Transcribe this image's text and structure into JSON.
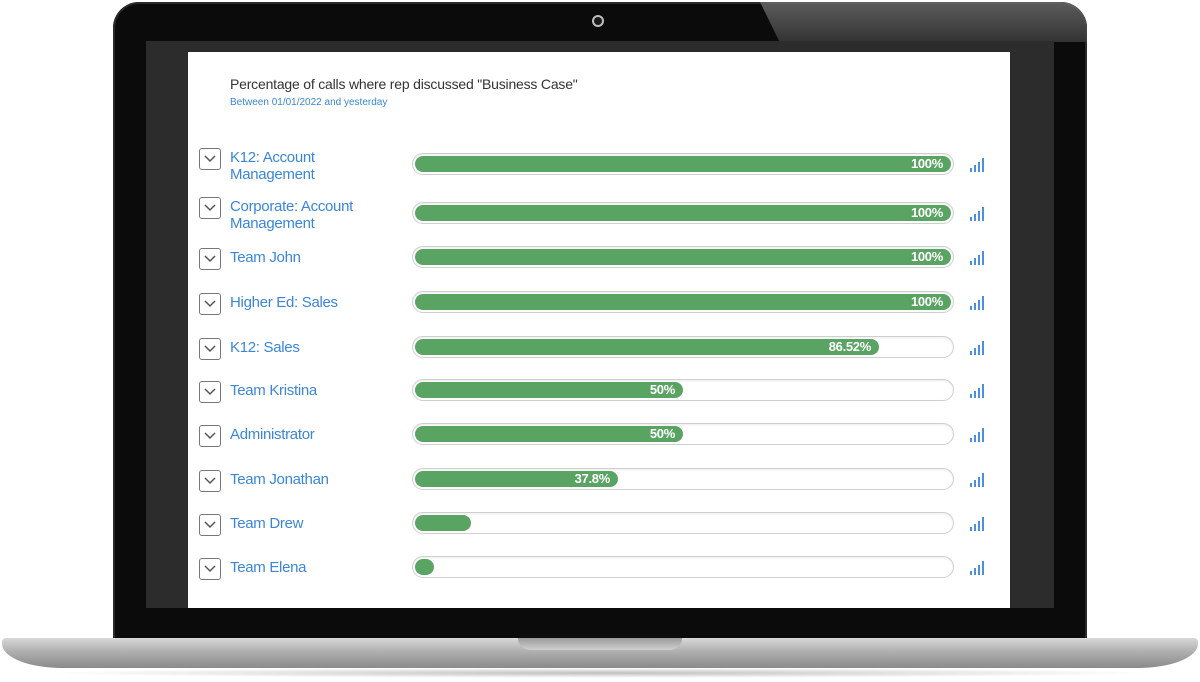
{
  "chart": {
    "title": "Percentage of calls where rep discussed \"Business Case\"",
    "subtitle": "Between 01/01/2022 and yesterday"
  },
  "colors": {
    "bar_fill": "#5aa463",
    "link": "#3a86d8",
    "icon": "#4a8fe0"
  },
  "rows": [
    {
      "label": "K12: Account Management",
      "value": 100,
      "value_label": "100%"
    },
    {
      "label": "Corporate: Account Management",
      "value": 100,
      "value_label": "100%"
    },
    {
      "label": "Team John",
      "value": 100,
      "value_label": "100%"
    },
    {
      "label": "Higher Ed: Sales",
      "value": 100,
      "value_label": "100%"
    },
    {
      "label": "K12: Sales",
      "value": 86.52,
      "value_label": "86.52%"
    },
    {
      "label": "Team Kristina",
      "value": 50,
      "value_label": "50%"
    },
    {
      "label": "Administrator",
      "value": 50,
      "value_label": "50%"
    },
    {
      "label": "Team Jonathan",
      "value": 37.8,
      "value_label": "37.8%"
    },
    {
      "label": "Team Drew",
      "value": 10.5,
      "value_label": ""
    },
    {
      "label": "Team Elena",
      "value": 3.5,
      "value_label": ""
    }
  ],
  "icons": {
    "expand": "chevron-down-icon",
    "chart": "bar-chart-icon"
  }
}
